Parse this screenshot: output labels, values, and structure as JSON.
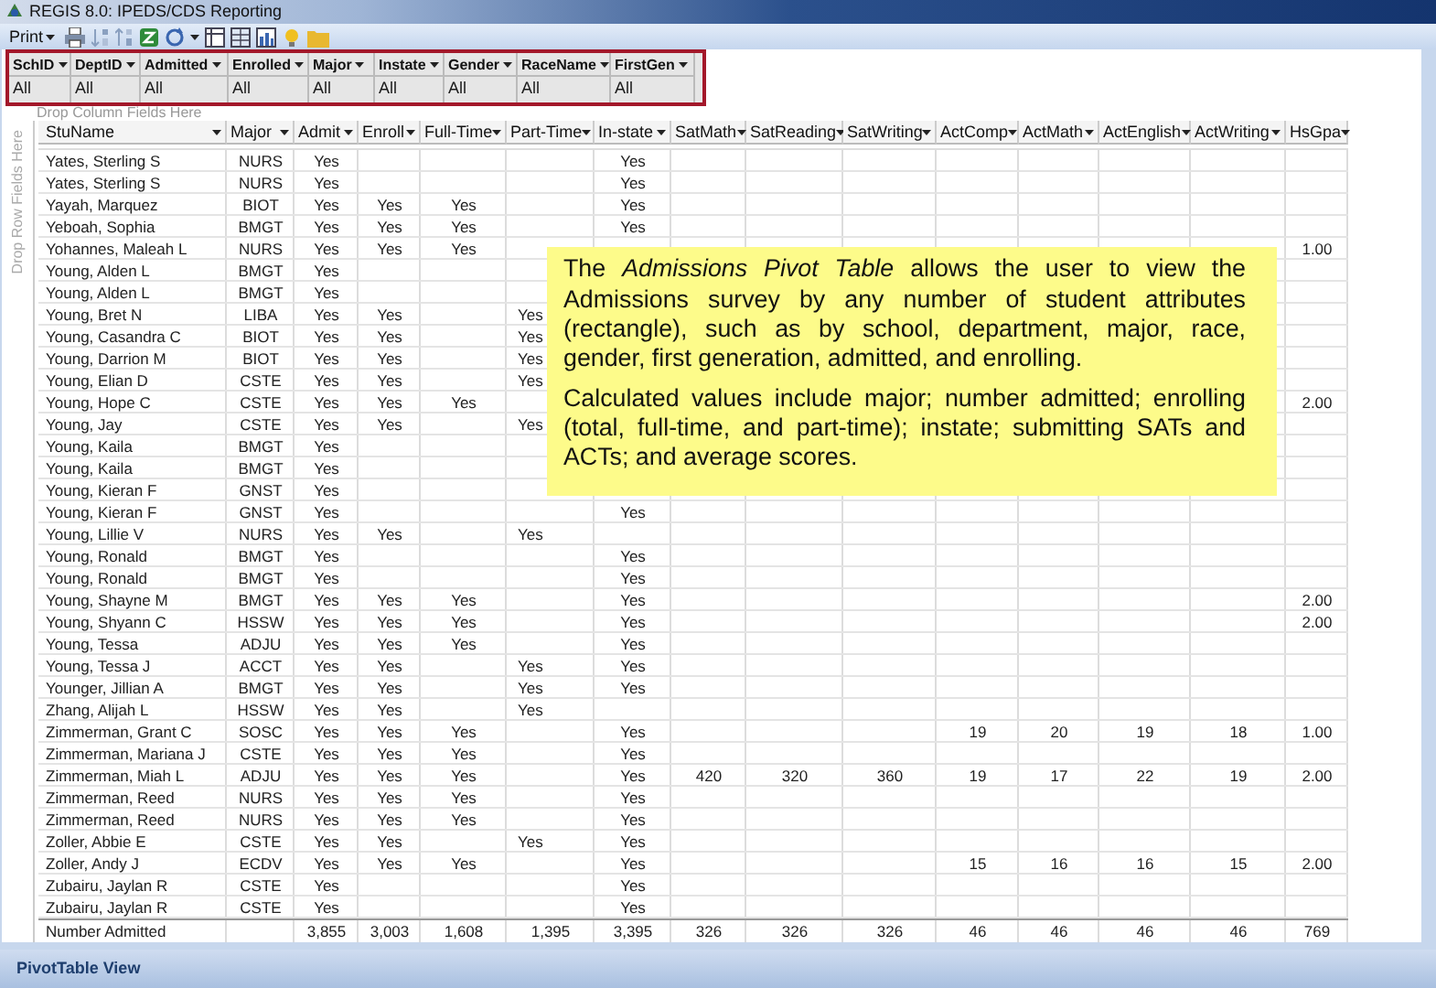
{
  "window": {
    "title": "REGIS 8.0: IPEDS/CDS Reporting"
  },
  "toolbar": {
    "print_label": "Print"
  },
  "filters": [
    {
      "field": "SchID",
      "value": "All"
    },
    {
      "field": "DeptID",
      "value": "All"
    },
    {
      "field": "Admitted",
      "value": "All"
    },
    {
      "field": "Enrolled",
      "value": "All"
    },
    {
      "field": "Major",
      "value": "All"
    },
    {
      "field": "Instate",
      "value": "All"
    },
    {
      "field": "Gender",
      "value": "All"
    },
    {
      "field": "RaceName",
      "value": "All"
    },
    {
      "field": "FirstGen",
      "value": "All"
    }
  ],
  "drop_column_hint": "Drop Column Fields Here",
  "drop_row_hint": "Drop Row Fields Here",
  "table": {
    "columns": [
      "StuName",
      "Major",
      "Admit",
      "Enroll",
      "Full-Time",
      "Part-Time",
      "In-state",
      "SatMath",
      "SatReading",
      "SatWriting",
      "ActComp",
      "ActMath",
      "ActEnglish",
      "ActWriting",
      "HsGpa"
    ],
    "rows": [
      [
        "Yates, Sterling S",
        "NURS",
        "Yes",
        null,
        null,
        null,
        "Yes",
        null,
        null,
        null,
        null,
        null,
        null,
        null,
        null
      ],
      [
        "Yates, Sterling S",
        "NURS",
        "Yes",
        null,
        null,
        null,
        "Yes",
        null,
        null,
        null,
        null,
        null,
        null,
        null,
        null
      ],
      [
        "Yayah, Marquez",
        "BIOT",
        "Yes",
        "Yes",
        "Yes",
        null,
        "Yes",
        null,
        null,
        null,
        null,
        null,
        null,
        null,
        null
      ],
      [
        "Yeboah, Sophia",
        "BMGT",
        "Yes",
        "Yes",
        "Yes",
        null,
        "Yes",
        null,
        null,
        null,
        null,
        null,
        null,
        null,
        null
      ],
      [
        "Yohannes, Maleah L",
        "NURS",
        "Yes",
        "Yes",
        "Yes",
        null,
        null,
        null,
        null,
        null,
        null,
        null,
        null,
        null,
        "1.00"
      ],
      [
        "Young, Alden L",
        "BMGT",
        "Yes",
        null,
        null,
        null,
        null,
        null,
        null,
        null,
        null,
        null,
        null,
        null,
        null
      ],
      [
        "Young, Alden L",
        "BMGT",
        "Yes",
        null,
        null,
        null,
        null,
        null,
        null,
        null,
        null,
        null,
        null,
        null,
        null
      ],
      [
        "Young, Bret N",
        "LIBA",
        "Yes",
        "Yes",
        null,
        "Yes",
        null,
        null,
        null,
        null,
        null,
        null,
        null,
        null,
        null
      ],
      [
        "Young, Casandra C",
        "BIOT",
        "Yes",
        "Yes",
        null,
        "Yes",
        null,
        null,
        null,
        null,
        null,
        null,
        null,
        null,
        null
      ],
      [
        "Young, Darrion M",
        "BIOT",
        "Yes",
        "Yes",
        null,
        "Yes",
        null,
        null,
        null,
        null,
        null,
        null,
        null,
        null,
        null
      ],
      [
        "Young, Elian D",
        "CSTE",
        "Yes",
        "Yes",
        null,
        "Yes",
        null,
        null,
        null,
        null,
        null,
        null,
        null,
        null,
        null
      ],
      [
        "Young, Hope C",
        "CSTE",
        "Yes",
        "Yes",
        "Yes",
        null,
        null,
        null,
        null,
        null,
        null,
        null,
        null,
        null,
        "2.00"
      ],
      [
        "Young, Jay",
        "CSTE",
        "Yes",
        "Yes",
        null,
        "Yes",
        null,
        null,
        null,
        null,
        null,
        null,
        null,
        null,
        null
      ],
      [
        "Young, Kaila",
        "BMGT",
        "Yes",
        null,
        null,
        null,
        null,
        null,
        null,
        null,
        null,
        null,
        null,
        null,
        null
      ],
      [
        "Young, Kaila",
        "BMGT",
        "Yes",
        null,
        null,
        null,
        null,
        null,
        null,
        null,
        null,
        null,
        null,
        null,
        null
      ],
      [
        "Young, Kieran F",
        "GNST",
        "Yes",
        null,
        null,
        null,
        null,
        null,
        null,
        null,
        null,
        null,
        null,
        null,
        null
      ],
      [
        "Young, Kieran F",
        "GNST",
        "Yes",
        null,
        null,
        null,
        "Yes",
        null,
        null,
        null,
        null,
        null,
        null,
        null,
        null
      ],
      [
        "Young, Lillie V",
        "NURS",
        "Yes",
        "Yes",
        null,
        "Yes",
        null,
        null,
        null,
        null,
        null,
        null,
        null,
        null,
        null
      ],
      [
        "Young, Ronald",
        "BMGT",
        "Yes",
        null,
        null,
        null,
        "Yes",
        null,
        null,
        null,
        null,
        null,
        null,
        null,
        null
      ],
      [
        "Young, Ronald",
        "BMGT",
        "Yes",
        null,
        null,
        null,
        "Yes",
        null,
        null,
        null,
        null,
        null,
        null,
        null,
        null
      ],
      [
        "Young, Shayne M",
        "BMGT",
        "Yes",
        "Yes",
        "Yes",
        null,
        "Yes",
        null,
        null,
        null,
        null,
        null,
        null,
        null,
        "2.00"
      ],
      [
        "Young, Shyann C",
        "HSSW",
        "Yes",
        "Yes",
        "Yes",
        null,
        "Yes",
        null,
        null,
        null,
        null,
        null,
        null,
        null,
        "2.00"
      ],
      [
        "Young, Tessa",
        "ADJU",
        "Yes",
        "Yes",
        "Yes",
        null,
        "Yes",
        null,
        null,
        null,
        null,
        null,
        null,
        null,
        null
      ],
      [
        "Young, Tessa J",
        "ACCT",
        "Yes",
        "Yes",
        null,
        "Yes",
        "Yes",
        null,
        null,
        null,
        null,
        null,
        null,
        null,
        null
      ],
      [
        "Younger, Jillian A",
        "BMGT",
        "Yes",
        "Yes",
        null,
        "Yes",
        "Yes",
        null,
        null,
        null,
        null,
        null,
        null,
        null,
        null
      ],
      [
        "Zhang, Alijah L",
        "HSSW",
        "Yes",
        "Yes",
        null,
        "Yes",
        null,
        null,
        null,
        null,
        null,
        null,
        null,
        null,
        null
      ],
      [
        "Zimmerman, Grant C",
        "SOSC",
        "Yes",
        "Yes",
        "Yes",
        null,
        "Yes",
        null,
        null,
        null,
        "19",
        "20",
        "19",
        "18",
        "1.00"
      ],
      [
        "Zimmerman, Mariana J",
        "CSTE",
        "Yes",
        "Yes",
        "Yes",
        null,
        "Yes",
        null,
        null,
        null,
        null,
        null,
        null,
        null,
        null
      ],
      [
        "Zimmerman, Miah L",
        "ADJU",
        "Yes",
        "Yes",
        "Yes",
        null,
        "Yes",
        "420",
        "320",
        "360",
        "19",
        "17",
        "22",
        "19",
        "2.00"
      ],
      [
        "Zimmerman, Reed",
        "NURS",
        "Yes",
        "Yes",
        "Yes",
        null,
        "Yes",
        null,
        null,
        null,
        null,
        null,
        null,
        null,
        null
      ],
      [
        "Zimmerman, Reed",
        "NURS",
        "Yes",
        "Yes",
        "Yes",
        null,
        "Yes",
        null,
        null,
        null,
        null,
        null,
        null,
        null,
        null
      ],
      [
        "Zoller, Abbie E",
        "CSTE",
        "Yes",
        "Yes",
        null,
        "Yes",
        "Yes",
        null,
        null,
        null,
        null,
        null,
        null,
        null,
        null
      ],
      [
        "Zoller, Andy J",
        "ECDV",
        "Yes",
        "Yes",
        "Yes",
        null,
        "Yes",
        null,
        null,
        null,
        "15",
        "16",
        "16",
        "15",
        "2.00"
      ],
      [
        "Zubairu, Jaylan R",
        "CSTE",
        "Yes",
        null,
        null,
        null,
        "Yes",
        null,
        null,
        null,
        null,
        null,
        null,
        null,
        null
      ],
      [
        "Zubairu, Jaylan R",
        "CSTE",
        "Yes",
        null,
        null,
        null,
        "Yes",
        null,
        null,
        null,
        null,
        null,
        null,
        null,
        null
      ]
    ],
    "total_row": {
      "label": "Number Admitted",
      "values": [
        "3,855",
        "3,003",
        "1,608",
        "1,395",
        "3,395",
        "326",
        "326",
        "326",
        "46",
        "46",
        "46",
        "46",
        "769"
      ]
    }
  },
  "note": {
    "paragraphs": [
      "The *Admissions Pivot Table* allows the user to view the Admissions survey by any number of student attributes (rectangle), such as by school, department, major, race, gender, first generation, admitted, and enrolling.",
      "Calculated values include major; number admitted; enrolling (total, full-time, and part-time); instate; submitting SATs and ACTs; and average scores."
    ]
  },
  "status_bar": "PivotTable View"
}
